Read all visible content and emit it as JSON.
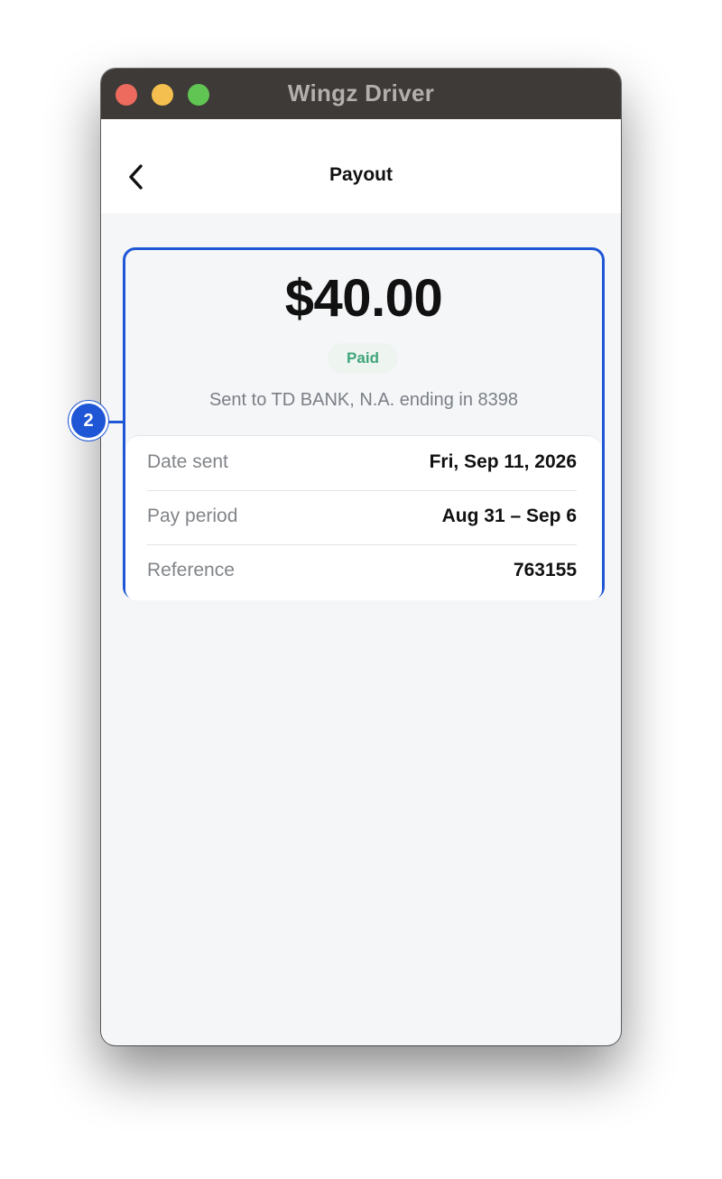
{
  "window": {
    "title": "Wingz Driver"
  },
  "navbar": {
    "title": "Payout",
    "back_icon": "chevron-left-icon"
  },
  "payout": {
    "amount": "$40.00",
    "status": "Paid",
    "sent_to": "Sent to TD BANK, N.A. ending in 8398",
    "details": [
      {
        "label": "Date sent",
        "value": "Fri, Sep 11, 2026"
      },
      {
        "label": "Pay period",
        "value": "Aug 31 – Sep 6"
      },
      {
        "label": "Reference",
        "value": "763155"
      }
    ]
  },
  "annotation": {
    "badge_number": "2"
  },
  "colors": {
    "accent_blue": "#1f56d6",
    "status_green": "#3fa57a",
    "titlebar": "#3d3a37"
  }
}
